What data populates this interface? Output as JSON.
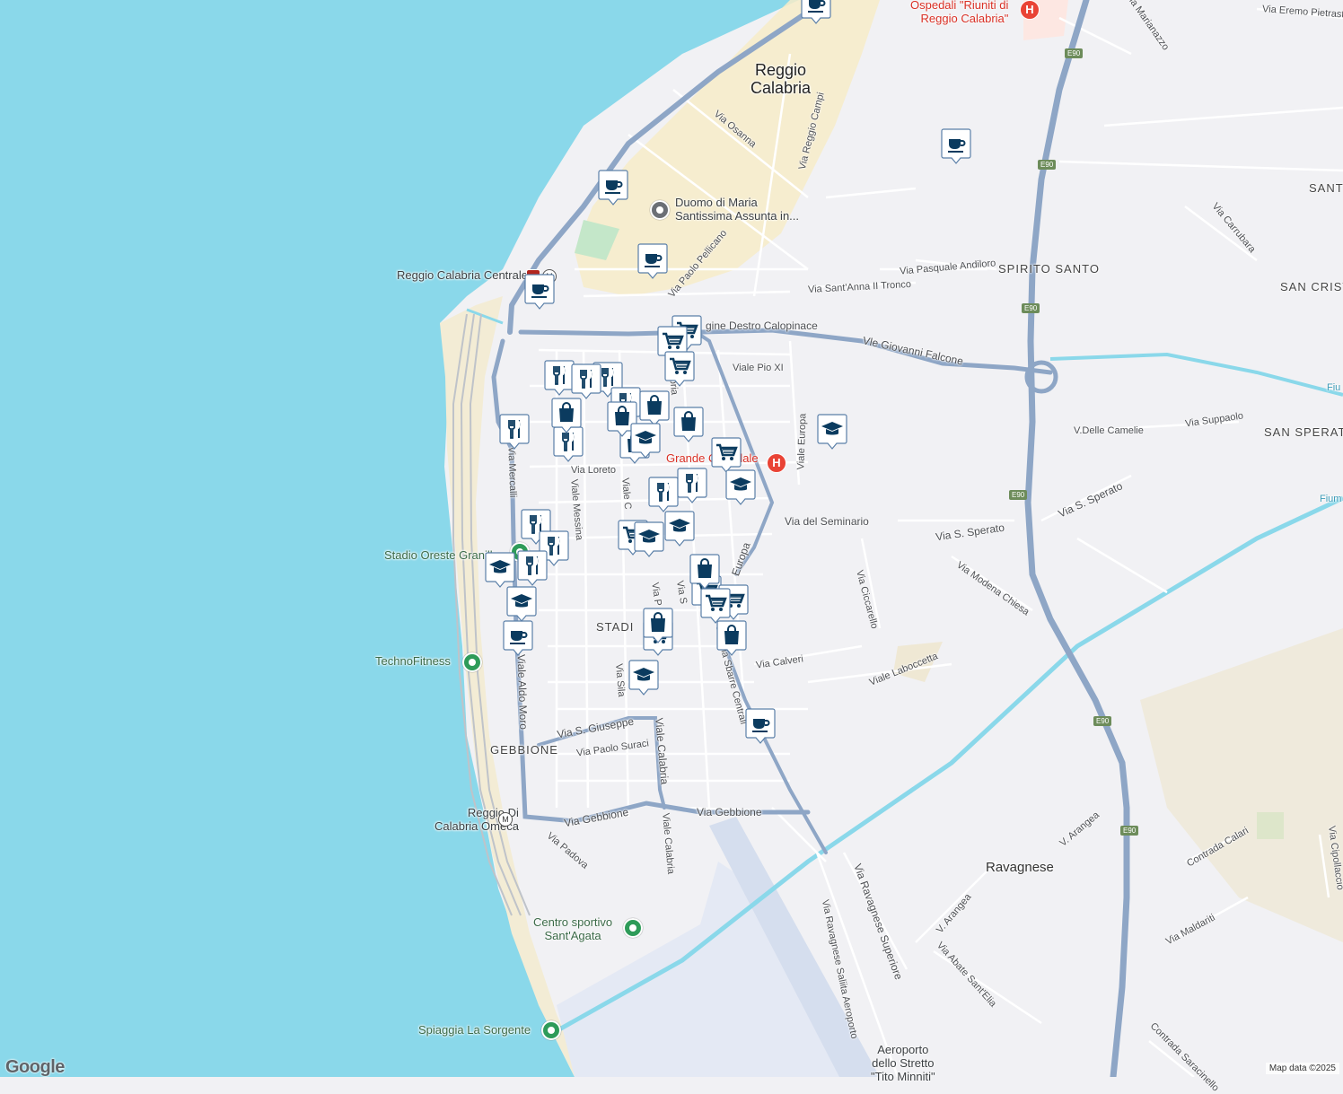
{
  "map": {
    "colors": {
      "water": "#8ad8ea",
      "land": "#f1f1f4",
      "major_road": "#8ea6c6",
      "minor_road": "#ffffff",
      "center_area": "#f7ecc8",
      "park": "#c4e7c9",
      "marker_fill": "#ffffff",
      "marker_icon": "#0b3b5f",
      "poi_green": "#2e9b59",
      "hospital_red": "#e94335"
    },
    "city_label": "Reggio\nCalabria",
    "district_labels": [
      {
        "id": "spirito-santo",
        "text": "SPIRITO SANTO"
      },
      {
        "id": "santo",
        "text": "SANT"
      },
      {
        "id": "san-cristoforo",
        "text": "SAN CRIST"
      },
      {
        "id": "san-sperato",
        "text": "SAN SPERAT"
      },
      {
        "id": "stadio",
        "text": "STADI"
      },
      {
        "id": "gebbione",
        "text": "GEBBIONE"
      },
      {
        "id": "ravagnese",
        "text": "Ravagnese"
      }
    ],
    "street_labels": [
      {
        "text": "Via Osanna"
      },
      {
        "text": "Via Reggio Campi"
      },
      {
        "text": "Via Paolo Pellicano"
      },
      {
        "text": "Via Pasquale Andiloro"
      },
      {
        "text": "Via Sant'Anna II Tronco"
      },
      {
        "text": "gine Destro Calopinace"
      },
      {
        "text": "Vle Giovanni Falcone"
      },
      {
        "text": "Viale Pio XI"
      },
      {
        "text": "Viale Europa"
      },
      {
        "text": "Via Loreto"
      },
      {
        "text": "Viale Messina"
      },
      {
        "text": "Via Mercalli"
      },
      {
        "text": "Via del Seminario"
      },
      {
        "text": "Via S. Sperato"
      },
      {
        "text": "Via S. Sperato"
      },
      {
        "text": "Via Modena Chiesa"
      },
      {
        "text": "Via Ciccarello"
      },
      {
        "text": "Viale Laboccetta"
      },
      {
        "text": "Via Calveri"
      },
      {
        "text": "Via Sbarre Centrali"
      },
      {
        "text": "Via Sila"
      },
      {
        "text": "Via S. Giuseppe"
      },
      {
        "text": "Via Paolo Suraci"
      },
      {
        "text": "Viale Calabria"
      },
      {
        "text": "Viale Calabria"
      },
      {
        "text": "Via Gebbione"
      },
      {
        "text": "Via Gebbione"
      },
      {
        "text": "Via Padova"
      },
      {
        "text": "Viale Aldo Moro"
      },
      {
        "text": "Via Ravagnese Superiore"
      },
      {
        "text": "Via Ravagnese Saliita Aeroporto"
      },
      {
        "text": "V. Arangea"
      },
      {
        "text": "V. Arangea"
      },
      {
        "text": "Via Abate Sant'Elia"
      },
      {
        "text": "Contrada Calari"
      },
      {
        "text": "Via Maldariti"
      },
      {
        "text": "Via Cipollaccio"
      },
      {
        "text": "Contrada Saracinello"
      },
      {
        "text": "Via Carrubara"
      },
      {
        "text": "V.Delle Camelie"
      },
      {
        "text": "Via Suppaolo"
      },
      {
        "text": "Via Marianazzo"
      },
      {
        "text": "Via Eremo Pietrastorta"
      },
      {
        "text": "Europa"
      },
      {
        "text": "Viale C"
      },
      {
        "text": "Via P"
      },
      {
        "text": "Via S"
      },
      {
        "text": "Fiu"
      },
      {
        "text": "Fium"
      },
      {
        "text": "Viale Calabria"
      }
    ],
    "poi_labels": [
      {
        "id": "hospital-riuniti",
        "text": "Ospedali \"Riuniti di\nReggio Calabria\""
      },
      {
        "id": "duomo",
        "text": "Duomo di Maria\nSantissima Assunta in..."
      },
      {
        "id": "station-centrale",
        "text": "Reggio Calabria Centrale"
      },
      {
        "id": "grande-ospedale",
        "text": "Grande Ospedale"
      },
      {
        "id": "stadio-granillo",
        "text": "Stadio Oreste Granillo"
      },
      {
        "id": "technofitness",
        "text": "TechnoFitness"
      },
      {
        "id": "omeca",
        "text": "Reggio Di\nCalabria Omeca"
      },
      {
        "id": "centro-sportivo",
        "text": "Centro sportivo\nSant'Agata"
      },
      {
        "id": "spiaggia",
        "text": "Spiaggia La Sorgente"
      },
      {
        "id": "aeroporto",
        "text": "Aeroporto\ndello Stretto\n\"Tito Minniti\""
      }
    ],
    "route_shields": [
      "E90",
      "E90",
      "E90",
      "E90",
      "E90",
      "E90"
    ],
    "markers": [
      {
        "type": "cafe"
      },
      {
        "type": "cafe"
      },
      {
        "type": "cafe"
      },
      {
        "type": "cafe"
      },
      {
        "type": "cafe"
      },
      {
        "type": "cafe"
      },
      {
        "type": "cafe"
      },
      {
        "type": "cart"
      },
      {
        "type": "cart"
      },
      {
        "type": "cart"
      },
      {
        "type": "cart"
      },
      {
        "type": "cart"
      },
      {
        "type": "cart"
      },
      {
        "type": "cart"
      },
      {
        "type": "cart"
      },
      {
        "type": "cart"
      },
      {
        "type": "restaurant"
      },
      {
        "type": "restaurant"
      },
      {
        "type": "restaurant"
      },
      {
        "type": "restaurant"
      },
      {
        "type": "restaurant"
      },
      {
        "type": "restaurant"
      },
      {
        "type": "restaurant"
      },
      {
        "type": "restaurant"
      },
      {
        "type": "restaurant"
      },
      {
        "type": "restaurant"
      },
      {
        "type": "restaurant"
      },
      {
        "type": "shop"
      },
      {
        "type": "shop"
      },
      {
        "type": "shop"
      },
      {
        "type": "shop"
      },
      {
        "type": "shop"
      },
      {
        "type": "shop"
      },
      {
        "type": "shop"
      },
      {
        "type": "shop"
      },
      {
        "type": "school"
      },
      {
        "type": "school"
      },
      {
        "type": "school"
      },
      {
        "type": "school"
      },
      {
        "type": "school"
      },
      {
        "type": "school"
      },
      {
        "type": "school"
      },
      {
        "type": "school"
      }
    ]
  },
  "branding": {
    "logo": "Google",
    "attribution": "Map data ©2025"
  }
}
